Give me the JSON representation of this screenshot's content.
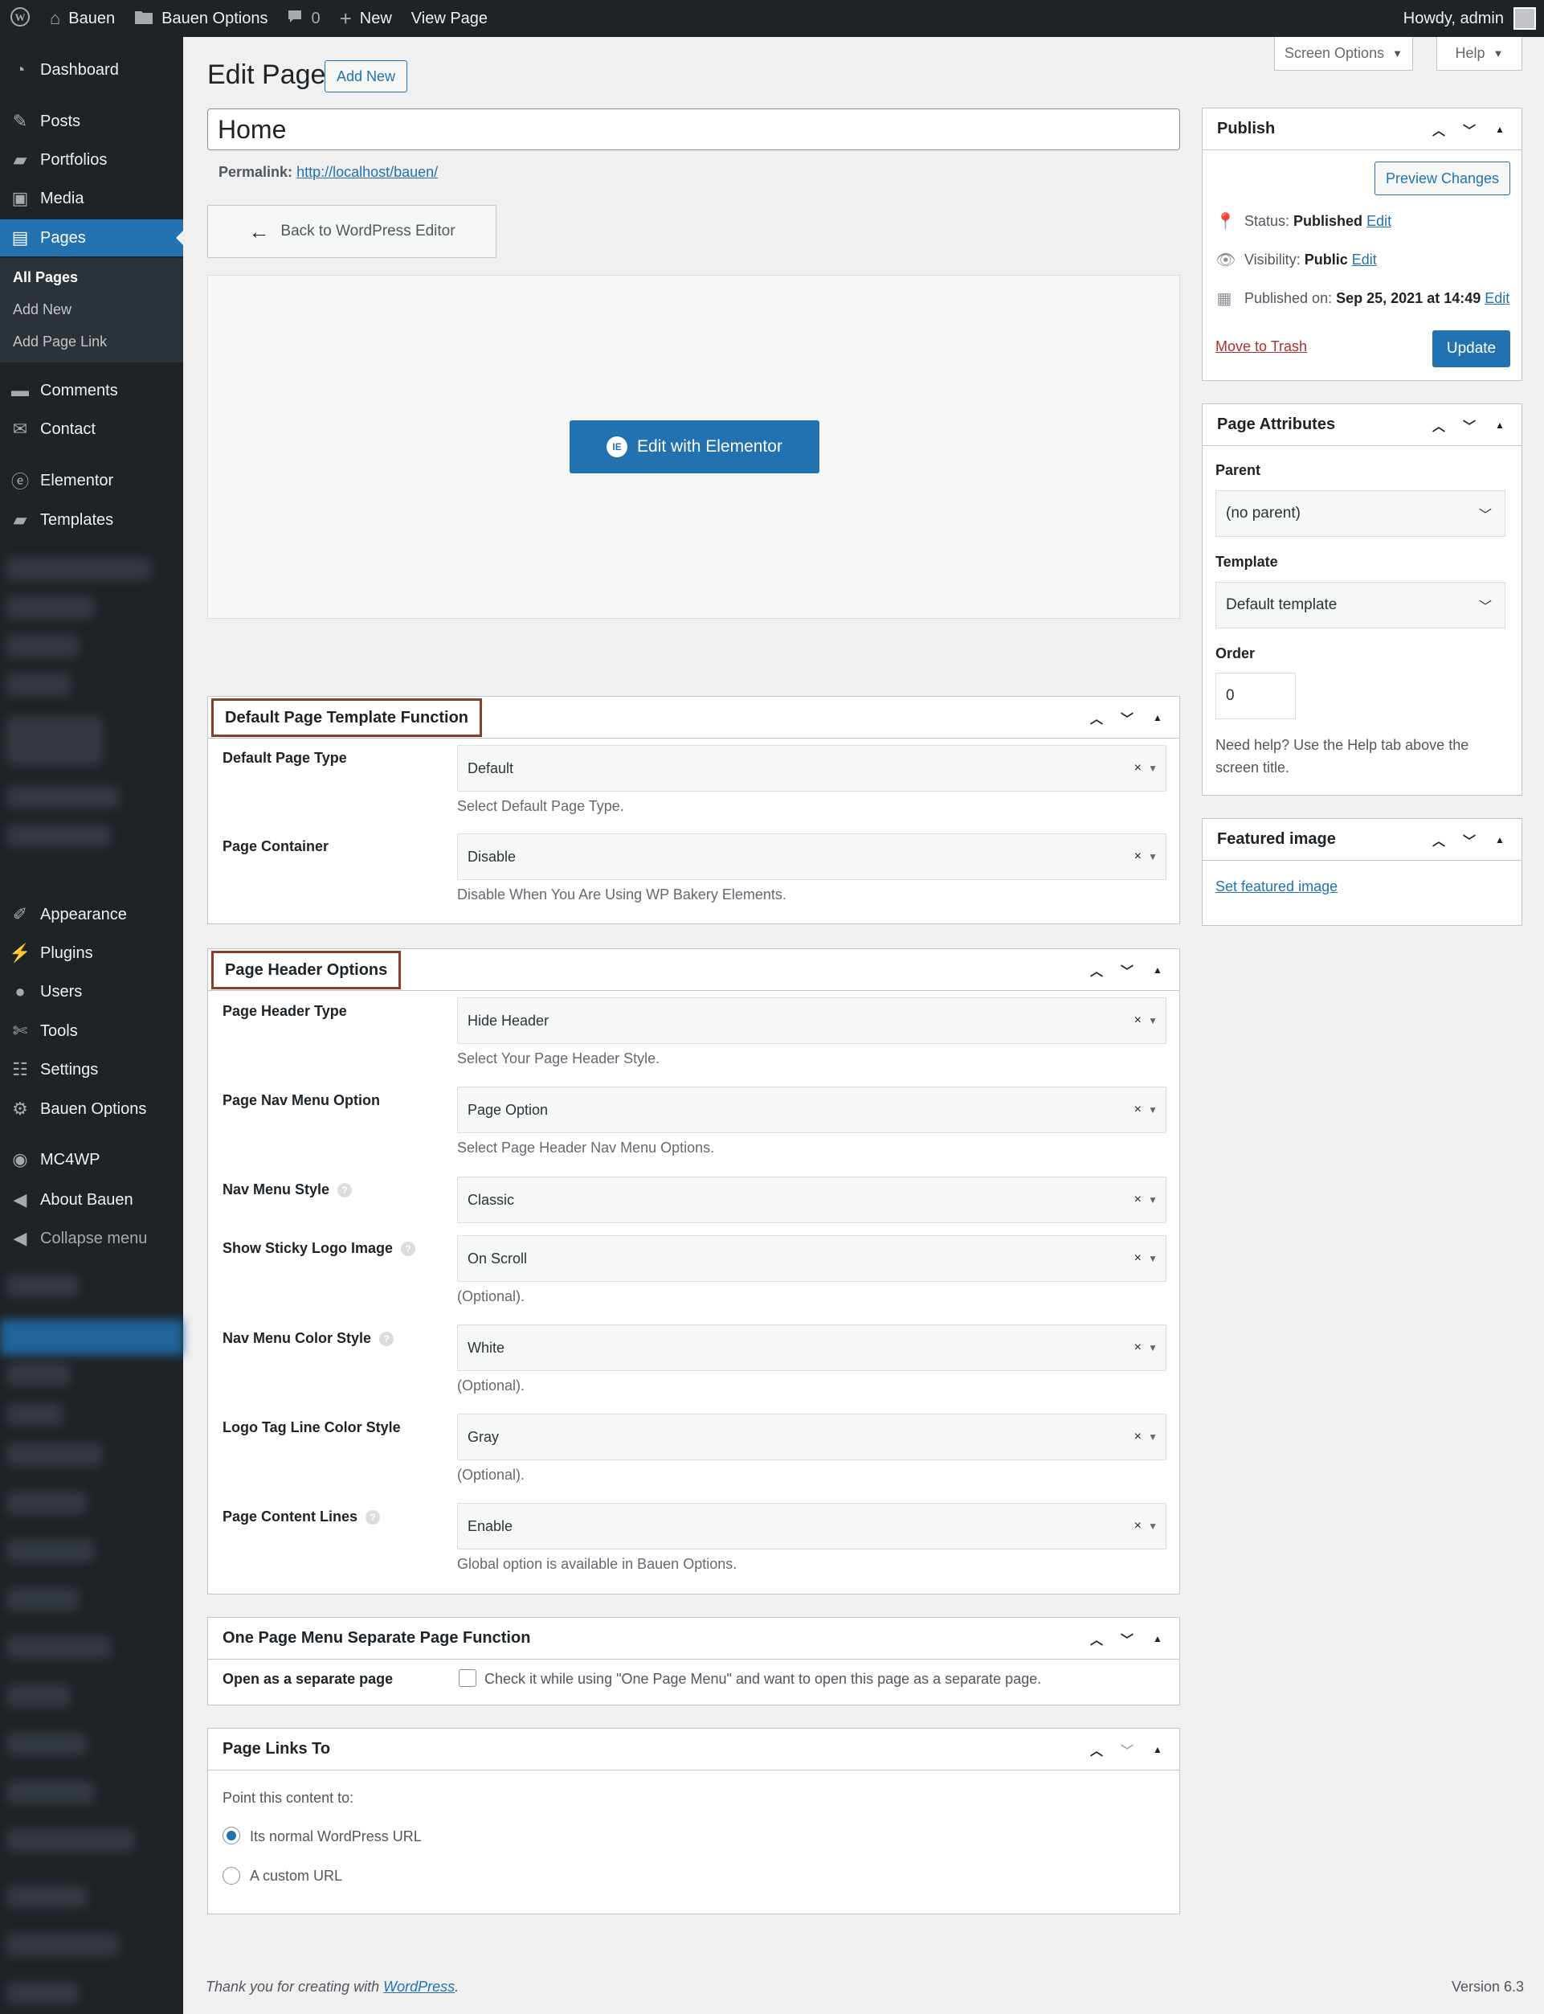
{
  "adminbar": {
    "site_name": "Bauen",
    "options": "Bauen Options",
    "comments_count": "0",
    "new_label": "New",
    "view_page": "View Page",
    "howdy": "Howdy, admin"
  },
  "sidebar": {
    "dashboard": "Dashboard",
    "posts": "Posts",
    "portfolios": "Portfolios",
    "media": "Media",
    "pages": "Pages",
    "all_pages": "All Pages",
    "add_new": "Add New",
    "add_page_link": "Add Page Link",
    "comments": "Comments",
    "contact": "Contact",
    "elementor": "Elementor",
    "templates": "Templates",
    "appearance": "Appearance",
    "plugins": "Plugins",
    "users": "Users",
    "tools": "Tools",
    "settings": "Settings",
    "bauen_options": "Bauen Options",
    "mc4wp": "MC4WP",
    "about_bauen": "About Bauen",
    "collapse": "Collapse menu"
  },
  "screen_options": "Screen Options",
  "help": "Help",
  "heading": {
    "title": "Edit Page",
    "add_new": "Add New"
  },
  "post": {
    "title": "Home",
    "permalink_label": "Permalink:",
    "permalink_url": "http://localhost/bauen/",
    "back_button": "Back to WordPress Editor",
    "elementor_button": "Edit with Elementor"
  },
  "default_template": {
    "title": "Default Page Template Function",
    "page_type_label": "Default Page Type",
    "page_type_value": "Default",
    "page_type_desc": "Select Default Page Type.",
    "container_label": "Page Container",
    "container_value": "Disable",
    "container_desc": "Disable When You Are Using WP Bakery Elements."
  },
  "header_options": {
    "title": "Page Header Options",
    "rows": [
      {
        "label": "Page Header Type",
        "value": "Hide Header",
        "desc": "Select Your Page Header Style."
      },
      {
        "label": "Page Nav Menu Option",
        "value": "Page Option",
        "desc": "Select Page Header Nav Menu Options."
      },
      {
        "label": "Nav Menu Style",
        "value": "Classic",
        "desc": ""
      },
      {
        "label": "Show Sticky Logo Image",
        "value": "On Scroll",
        "desc": "(Optional)."
      },
      {
        "label": "Nav Menu Color Style",
        "value": "White",
        "desc": "(Optional)."
      },
      {
        "label": "Logo Tag Line Color Style",
        "value": "Gray",
        "desc": "(Optional)."
      },
      {
        "label": "Page Content Lines",
        "value": "Enable",
        "desc": "Global option is available in Bauen Options."
      }
    ]
  },
  "one_page": {
    "title": "One Page Menu Separate Page Function",
    "label": "Open as a separate page",
    "checkbox_text": "Check it while using \"One Page Menu\" and want to open this page as a separate page."
  },
  "page_links": {
    "title": "Page Links To",
    "prompt": "Point this content to:",
    "option_normal": "Its normal WordPress URL",
    "option_custom": "A custom URL"
  },
  "publish": {
    "title": "Publish",
    "preview": "Preview Changes",
    "status_label": "Status:",
    "status_value": "Published",
    "visibility_label": "Visibility:",
    "visibility_value": "Public",
    "published_label": "Published on:",
    "published_value": "Sep 25, 2021 at 14:49",
    "edit": "Edit",
    "trash": "Move to Trash",
    "update": "Update"
  },
  "attributes": {
    "title": "Page Attributes",
    "parent_label": "Parent",
    "parent_value": "(no parent)",
    "template_label": "Template",
    "template_value": "Default template",
    "order_label": "Order",
    "order_value": "0",
    "help_text_1": "Need help? Use the Help tab above the",
    "help_text_2": "screen title."
  },
  "featured": {
    "title": "Featured image",
    "link": "Set featured image"
  },
  "footer": {
    "thanks": "Thank you for creating with ",
    "wp_link": "WordPress",
    "version": "Version 6.3"
  }
}
